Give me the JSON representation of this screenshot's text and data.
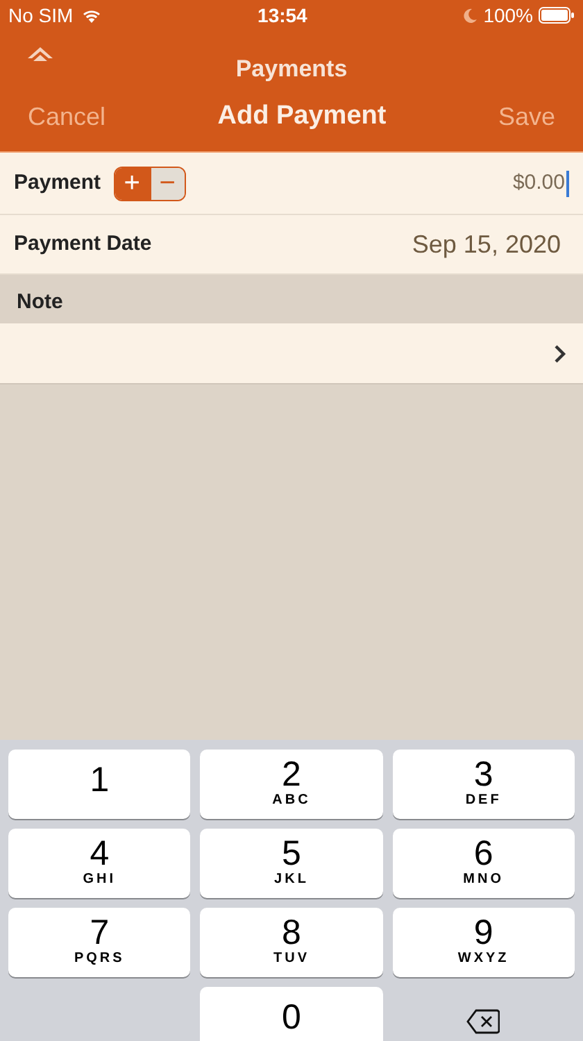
{
  "status_bar": {
    "carrier": "No SIM",
    "time": "13:54",
    "battery": "100%"
  },
  "parent_nav": {
    "title": "Payments"
  },
  "nav": {
    "cancel": "Cancel",
    "title": "Add Payment",
    "save": "Save"
  },
  "rows": [
    {
      "kind": "amount",
      "label": "Payment",
      "signs": [
        {
          "symbol": "+",
          "selected": true
        },
        {
          "symbol": "−",
          "selected": false
        }
      ],
      "value": "$0.00"
    },
    {
      "kind": "date",
      "label": "Payment Date",
      "value": "Sep 15, 2020"
    }
  ],
  "note": {
    "header": "Note"
  },
  "keypad": [
    {
      "digit": "1"
    },
    {
      "digit": "2",
      "letters": "ABC"
    },
    {
      "digit": "3",
      "letters": "DEF"
    },
    {
      "digit": "4",
      "letters": "GHI"
    },
    {
      "digit": "5",
      "letters": "JKL"
    },
    {
      "digit": "6",
      "letters": "MNO"
    },
    {
      "digit": "7",
      "letters": "PQRS"
    },
    {
      "digit": "8",
      "letters": "TUV"
    },
    {
      "digit": "9",
      "letters": "WXYZ"
    },
    {
      "kind": "blank"
    },
    {
      "digit": "0"
    },
    {
      "kind": "delete"
    }
  ]
}
